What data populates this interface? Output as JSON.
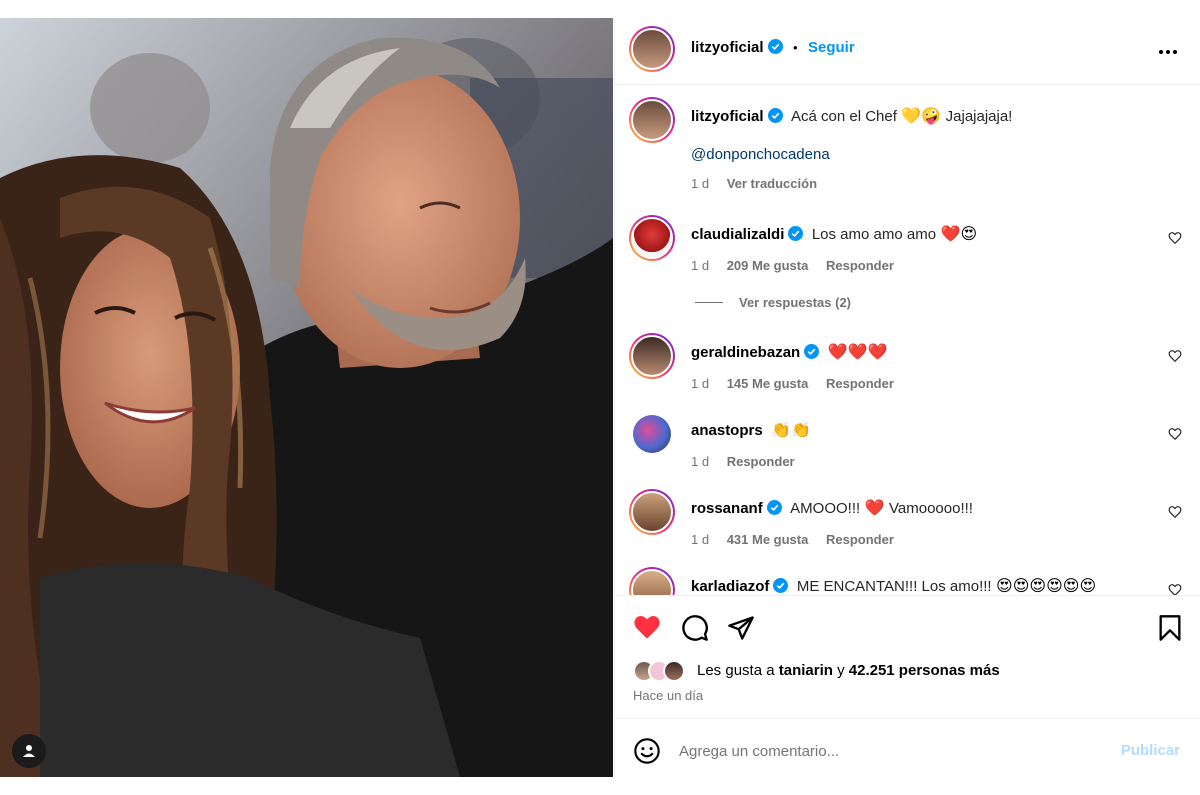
{
  "post": {
    "author": "litzyoficial",
    "follow_label": "Seguir",
    "dot": "•",
    "caption_text": "Acá con el Chef",
    "caption_emojis": "💛🤪",
    "caption_tail": "Jajajajaja!",
    "mention": "@donponchocadena",
    "caption_age": "1 d",
    "translate_label": "Ver traducción"
  },
  "comments": [
    {
      "user": "claudializaldi",
      "verified": true,
      "text": "Los amo amo amo",
      "emojis": "❤️😍",
      "age": "1 d",
      "likes": "209 Me gusta",
      "reply": "Responder",
      "view_replies": "Ver respuestas (2)"
    },
    {
      "user": "geraldinebazan",
      "verified": true,
      "text": "",
      "emojis": "❤️❤️❤️",
      "age": "1 d",
      "likes": "145 Me gusta",
      "reply": "Responder"
    },
    {
      "user": "anastoprs",
      "verified": false,
      "text": "",
      "emojis": "👏👏",
      "age": "1 d",
      "likes": "",
      "reply": "Responder"
    },
    {
      "user": "rossananf",
      "verified": true,
      "text": "AMOOO!!!",
      "emojis": "❤️",
      "tail": "Vamooooo!!!",
      "age": "1 d",
      "likes": "431 Me gusta",
      "reply": "Responder"
    },
    {
      "user": "karladiazof",
      "verified": true,
      "text": "ME ENCANTAN!!! Los amo!!!",
      "emojis": "😍😍😍😍😍😍"
    }
  ],
  "likes": {
    "prefix": "Les gusta a",
    "user": "taniarin",
    "conj": "y",
    "count": "42.251 personas más",
    "time": "Hace un día"
  },
  "add_comment": {
    "placeholder": "Agrega un comentario...",
    "publish_label": "Publicar"
  },
  "colors": {
    "accent": "#0095f6",
    "like_red": "#ff3040",
    "verified": "#0095f6"
  },
  "icons": [
    "more-icon",
    "verified-icon",
    "heart-icon",
    "comment-icon",
    "share-icon",
    "bookmark-icon",
    "emoji-icon",
    "user-tag-icon"
  ]
}
